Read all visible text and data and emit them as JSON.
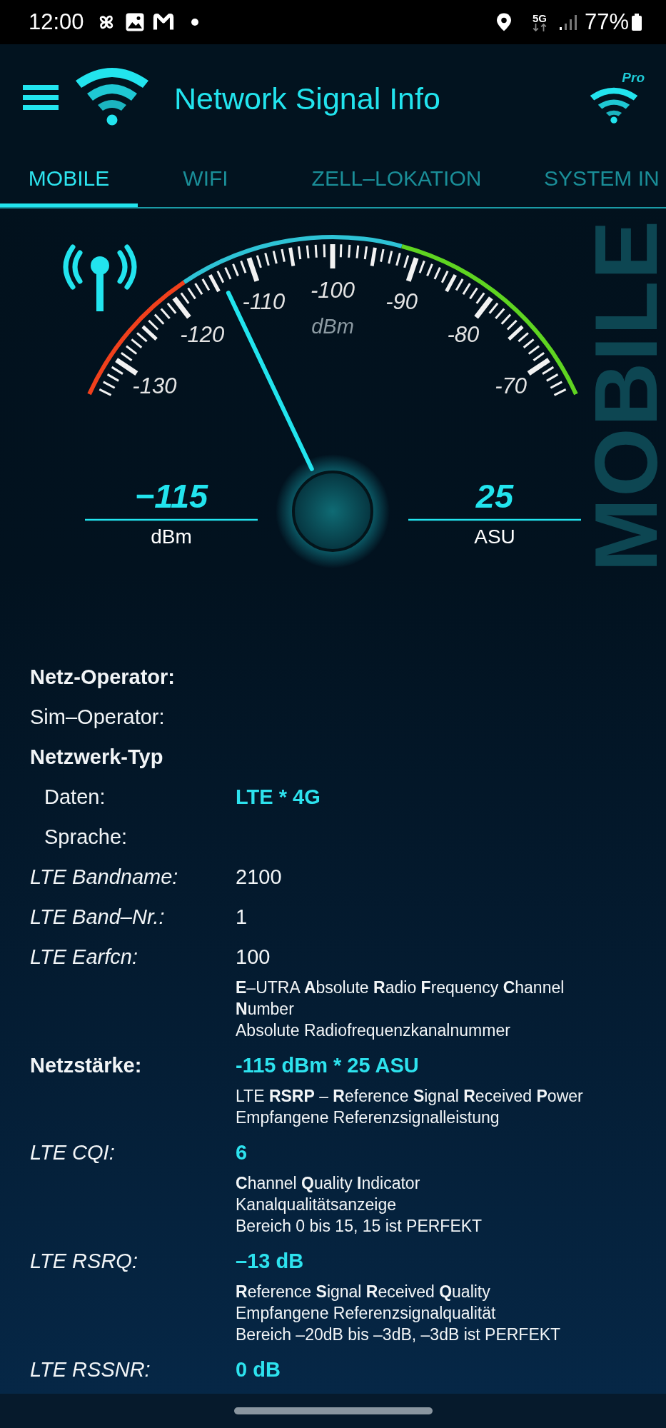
{
  "status_bar": {
    "time": "12:00",
    "network": "5G",
    "battery": "77%"
  },
  "app_bar": {
    "title": "Network Signal Info",
    "pro_badge": "Pro"
  },
  "tabs": [
    {
      "label": "MOBILE",
      "selected": true
    },
    {
      "label": "WIFI",
      "selected": false
    },
    {
      "label": "ZELL–LOKATION",
      "selected": false
    },
    {
      "label": "SYSTEM IN",
      "selected": false
    }
  ],
  "gauge": {
    "side_label": "MOBILE",
    "scale_labels": [
      "-130",
      "-120",
      "-110",
      "-100",
      "-90",
      "-80",
      "-70"
    ],
    "unit": "dBm",
    "readouts": [
      {
        "value": "−115",
        "unit": "dBm"
      },
      {
        "value": "25",
        "unit": "ASU"
      }
    ]
  },
  "details": [
    {
      "label": "Netz-Operator:",
      "kind": "bold"
    },
    {
      "label": "Sim–Operator:",
      "kind": "plain"
    },
    {
      "label": "Netzwerk-Typ",
      "kind": "bold",
      "children": [
        {
          "label": "Daten:",
          "kind": "plain",
          "value": "LTE * 4G",
          "highlight": true
        },
        {
          "label": "Sprache:",
          "kind": "plain"
        }
      ]
    },
    {
      "label": "LTE Bandname:",
      "kind": "italic",
      "value": "2100",
      "highlight": false
    },
    {
      "label": "LTE Band–Nr.:",
      "kind": "italic",
      "value": "1",
      "highlight": false
    },
    {
      "label": "LTE Earfcn:",
      "kind": "italic",
      "value": "100",
      "highlight": false,
      "notes": [
        "**E**–UTRA **A**bsolute **R**adio **F**requency **C**hannel **N**umber",
        "Absolute Radiofrequenzkanalnummer"
      ]
    },
    {
      "label": "Netzstärke:",
      "kind": "bold",
      "value": "-115 dBm * 25 ASU",
      "highlight": true,
      "notes": [
        "LTE **RSRP** – **R**eference **S**ignal **R**eceived **P**ower",
        "Empfangene Referenzsignalleistung"
      ]
    },
    {
      "label": "LTE CQI:",
      "kind": "italic",
      "value": "6",
      "highlight": true,
      "notes": [
        "**C**hannel **Q**uality **I**ndicator",
        "Kanalqualitätsanzeige",
        "Bereich 0 bis 15, 15 ist PERFEKT"
      ]
    },
    {
      "label": "LTE RSRQ:",
      "kind": "italic",
      "value": "–13 dB",
      "highlight": true,
      "notes": [
        "**R**eference **S**ignal **R**eceived **Q**uality",
        "Empfangene Referenzsignalqualität",
        "Bereich –20dB bis –3dB, –3dB ist PERFEKT"
      ]
    },
    {
      "label": "LTE RSSNR:",
      "kind": "italic",
      "value": "0 dB",
      "highlight": true
    }
  ]
}
